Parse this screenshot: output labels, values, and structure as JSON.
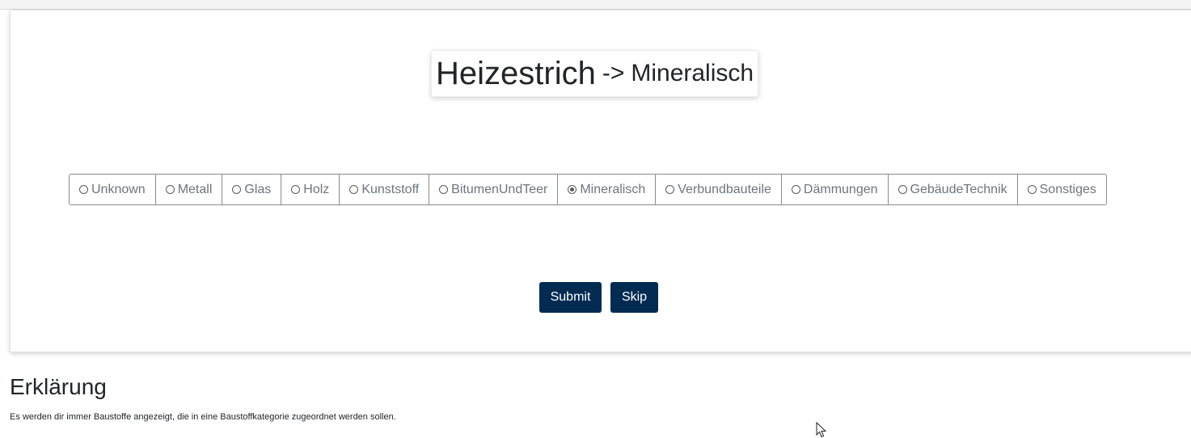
{
  "header": {
    "title_main": "Heizestrich",
    "title_arrow": "->",
    "title_target": "Mineralisch"
  },
  "categories": {
    "selected": "Mineralisch",
    "options": [
      {
        "label": "Unknown",
        "checked": false
      },
      {
        "label": "Metall",
        "checked": false
      },
      {
        "label": "Glas",
        "checked": false
      },
      {
        "label": "Holz",
        "checked": false
      },
      {
        "label": "Kunststoff",
        "checked": false
      },
      {
        "label": "BitumenUndTeer",
        "checked": false
      },
      {
        "label": "Mineralisch",
        "checked": true
      },
      {
        "label": "Verbundbauteile",
        "checked": false
      },
      {
        "label": "Dämmungen",
        "checked": false
      },
      {
        "label": "GebäudeTechnik",
        "checked": false
      },
      {
        "label": "Sonstiges",
        "checked": false
      }
    ]
  },
  "actions": {
    "submit_label": "Submit",
    "skip_label": "Skip"
  },
  "explanation": {
    "heading": "Erklärung",
    "text": "Es werden dir immer Baustoffe angezeigt, die in eine Baustoffkategorie zugeordnet werden sollen."
  },
  "colors": {
    "button_bg": "#022b52",
    "option_text": "#6c757d"
  }
}
